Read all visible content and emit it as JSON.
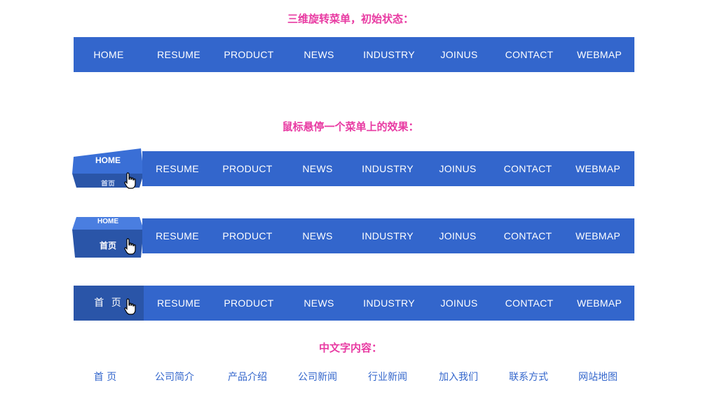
{
  "headings": {
    "initial": "三维旋转菜单，初始状态：",
    "hover": "鼠标悬停一个菜单上的效果：",
    "chinese": "中文字内容："
  },
  "menu_en": [
    "HOME",
    "RESUME",
    "PRODUCT",
    "NEWS",
    "INDUSTRY",
    "JOINUS",
    "CONTACT",
    "WEBMAP"
  ],
  "menu_cn": [
    "首 页",
    "公司简介",
    "产品介绍",
    "公司新闻",
    "行业新闻",
    "加入我们",
    "联系方式",
    "网站地图"
  ],
  "hover_states": {
    "state1_front": "HOME",
    "state1_bottom": "首页",
    "state2_top": "HOME",
    "state2_front": "首页",
    "state3_front": "首 页"
  },
  "colors": {
    "menu_bg": "#3366cc",
    "cube_dark": "#2a55a8",
    "heading": "#e83aa2",
    "cn_text": "#3366cc"
  },
  "icons": {
    "cursor": "hand-pointer-icon"
  }
}
